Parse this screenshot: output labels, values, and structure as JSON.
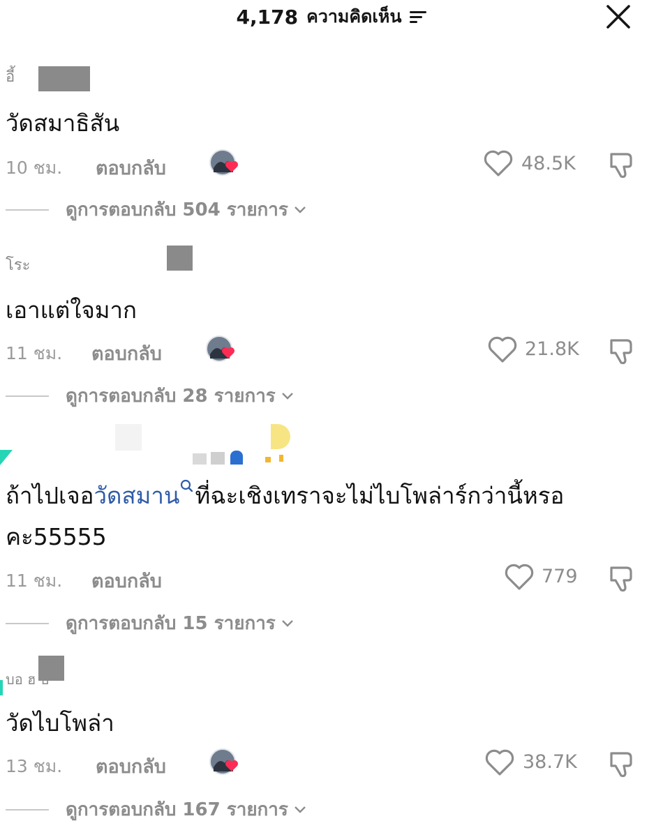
{
  "header": {
    "count": "4,178",
    "label": "ความคิดเห็น"
  },
  "comments": [
    {
      "username": "อี้",
      "text": "วัดสมาธิสัน",
      "time": "10 ชม.",
      "reply_label": "ตอบกลับ",
      "likes": "48.5K",
      "view_replies": "ดูการตอบกลับ 504 รายการ"
    },
    {
      "username": "โระ",
      "text": "เอาแต่ใจมาก",
      "time": "11 ชม.",
      "reply_label": "ตอบกลับ",
      "likes": "21.8K",
      "view_replies": "ดูการตอบกลับ 28 รายการ"
    },
    {
      "username": "",
      "text_before": "ถ้าไปเจอ",
      "hashtag": "วัดสมาน",
      "text_after": "ที่ฉะเชิงเทราจะไม่ไบโพล่าร์กว่านี้หรอ",
      "text_line2": "คะ55555",
      "time": "11 ชม.",
      "reply_label": "ตอบกลับ",
      "likes": "779",
      "view_replies": "ดูการตอบกลับ 15 รายการ"
    },
    {
      "username": "บอ ฮ บ",
      "text": "วัดไบโพล่า",
      "time": "13 ชม.",
      "reply_label": "ตอบกลับ",
      "likes": "38.7K",
      "view_replies": "ดูการตอบกลับ 167 รายการ"
    }
  ],
  "icons": {
    "close": "close-icon",
    "sort": "sort-icon",
    "heart": "heart-icon",
    "dislike": "thumbs-down-icon",
    "search": "search-icon",
    "chevron": "chevron-down-icon"
  },
  "colors": {
    "muted": "#8c8c8c",
    "hashtag": "#2f5ba8",
    "heart_badge": "#fe2c55"
  }
}
